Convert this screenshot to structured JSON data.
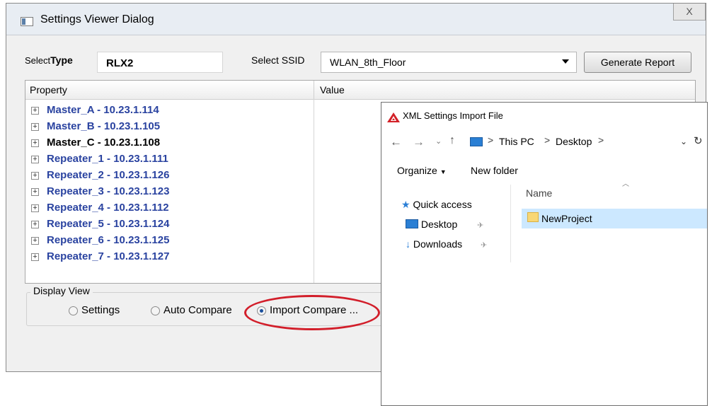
{
  "main_dialog": {
    "title": "Settings Viewer Dialog",
    "close_glyph": "X",
    "type_label_prefix": "Select",
    "type_label_bold": "Type",
    "type_value": "RLX2",
    "ssid_label": "Select SSID",
    "ssid_value": "WLAN_8th_Floor",
    "generate_button": "Generate Report",
    "columns": {
      "property": "Property",
      "value": "Value"
    },
    "rows": [
      {
        "label": "Master_A - 10.23.1.114"
      },
      {
        "label": "Master_B - 10.23.1.105"
      },
      {
        "label": "Master_C - 10.23.1.108"
      },
      {
        "label": "Repeater_1 - 10.23.1.111"
      },
      {
        "label": "Repeater_2 - 10.23.1.126"
      },
      {
        "label": "Repeater_3 - 10.23.1.123"
      },
      {
        "label": "Repeater_4 - 10.23.1.112"
      },
      {
        "label": "Repeater_5 - 10.23.1.124"
      },
      {
        "label": "Repeater_6 - 10.23.1.125"
      },
      {
        "label": "Repeater_7 - 10.23.1.127"
      }
    ],
    "expand_glyph": "+",
    "display_view": {
      "label": "Display View",
      "options": [
        "Settings",
        "Auto Compare",
        "Import Compare ..."
      ],
      "selected": "Import Compare ..."
    },
    "colors": {
      "link_blue": "#2a43a0",
      "highlight_ellipse": "#d21e2a"
    }
  },
  "xml_dialog": {
    "title": "XML Settings Import File",
    "nav_icons": [
      "back-arrow-icon",
      "forward-arrow-icon",
      "recent-chevron-icon",
      "up-arrow-icon",
      "this-pc-icon",
      "refresh-icon"
    ],
    "path": [
      "This PC",
      "Desktop"
    ],
    "path_separator": ">",
    "organize_label": "Organize",
    "new_folder_label": "New folder",
    "sidebar": [
      {
        "label": "Quick access",
        "icon": "star-icon"
      },
      {
        "label": "Desktop",
        "icon": "desktop-icon",
        "pinned": true
      },
      {
        "label": "Downloads",
        "icon": "download-icon",
        "pinned": true
      }
    ],
    "column_name": "Name",
    "files": [
      {
        "name": "NewProject",
        "icon": "folder-icon",
        "selected": true
      }
    ],
    "colors": {
      "selection": "#cce8ff",
      "folder": "#f8d775"
    }
  }
}
